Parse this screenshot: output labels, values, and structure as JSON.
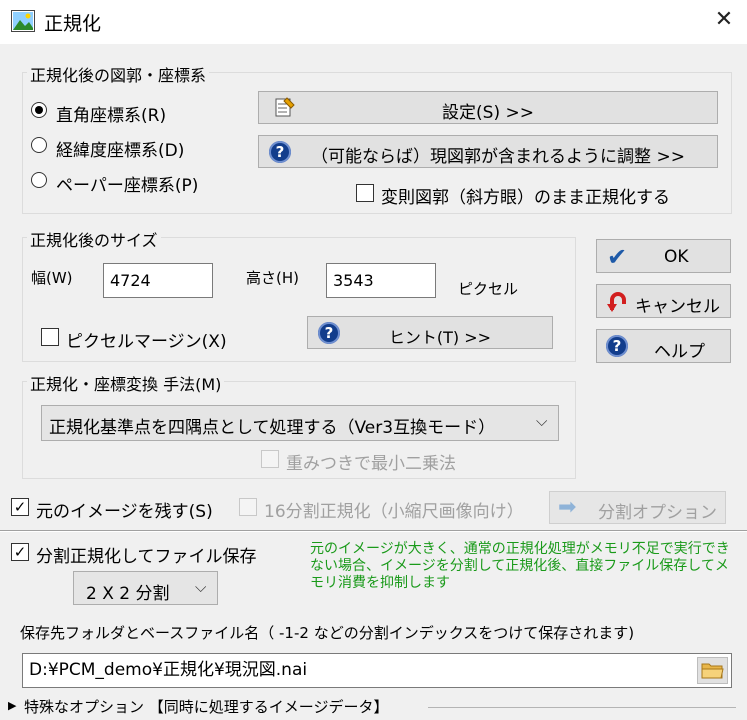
{
  "window": {
    "title": "正規化",
    "close": "✕"
  },
  "coord_group": {
    "label": "正規化後の図郭・座標系",
    "radios": [
      {
        "label": "直角座標系(R)",
        "selected": true
      },
      {
        "label": "経緯度座標系(D)",
        "selected": false
      },
      {
        "label": "ペーパー座標系(P)",
        "selected": false
      }
    ],
    "settings_button": "設定(S) >>",
    "adjust_button": "（可能ならば）現図郭が含まれるように調整 >>",
    "deformed_check": "変則図郭（斜方眼）のまま正規化する"
  },
  "size_group": {
    "label": "正規化後のサイズ",
    "width_label": "幅(W)",
    "width_value": "4724",
    "height_label": "高さ(H)",
    "height_value": "3543",
    "unit": "ピクセル",
    "margin_check": "ピクセルマージン(X)",
    "hint_button": "ヒント(T) >>"
  },
  "method_group": {
    "label": "正規化・座標変換 手法(M)",
    "selected": "正規化基準点を四隅点として処理する（Ver3互換モード）",
    "weighted_check": "重みつきで最小二乗法"
  },
  "side_buttons": {
    "ok": "OK",
    "cancel": "キャンセル",
    "help": "ヘルプ"
  },
  "keep_check": "元のイメージを残す(S)",
  "split16_check": "16分割正規化（小縮尺画像向け）",
  "split_option_button": "分割オプション",
  "split_save_check": "分割正規化してファイル保存",
  "split_select": "2 X 2 分割",
  "split_note": "元のイメージが大きく、通常の正規化処理がメモリ不足で実行できない場合、イメージを分割して正規化後、直接ファイル保存してメモリ消費を抑制します",
  "save_label": "保存先フォルダとベースファイル名（ -1-2 などの分割インデックスをつけて保存されます)",
  "save_path": "D:¥PCM_demo¥正規化¥現況図.nai",
  "special_options": "特殊なオプション 【同時に処理するイメージデータ】",
  "colors": {
    "question_icon": "#123d8c",
    "note_green": "#1a9a1a",
    "cancel_red": "#d21f1f",
    "ok_blue": "#1e5aa8"
  }
}
